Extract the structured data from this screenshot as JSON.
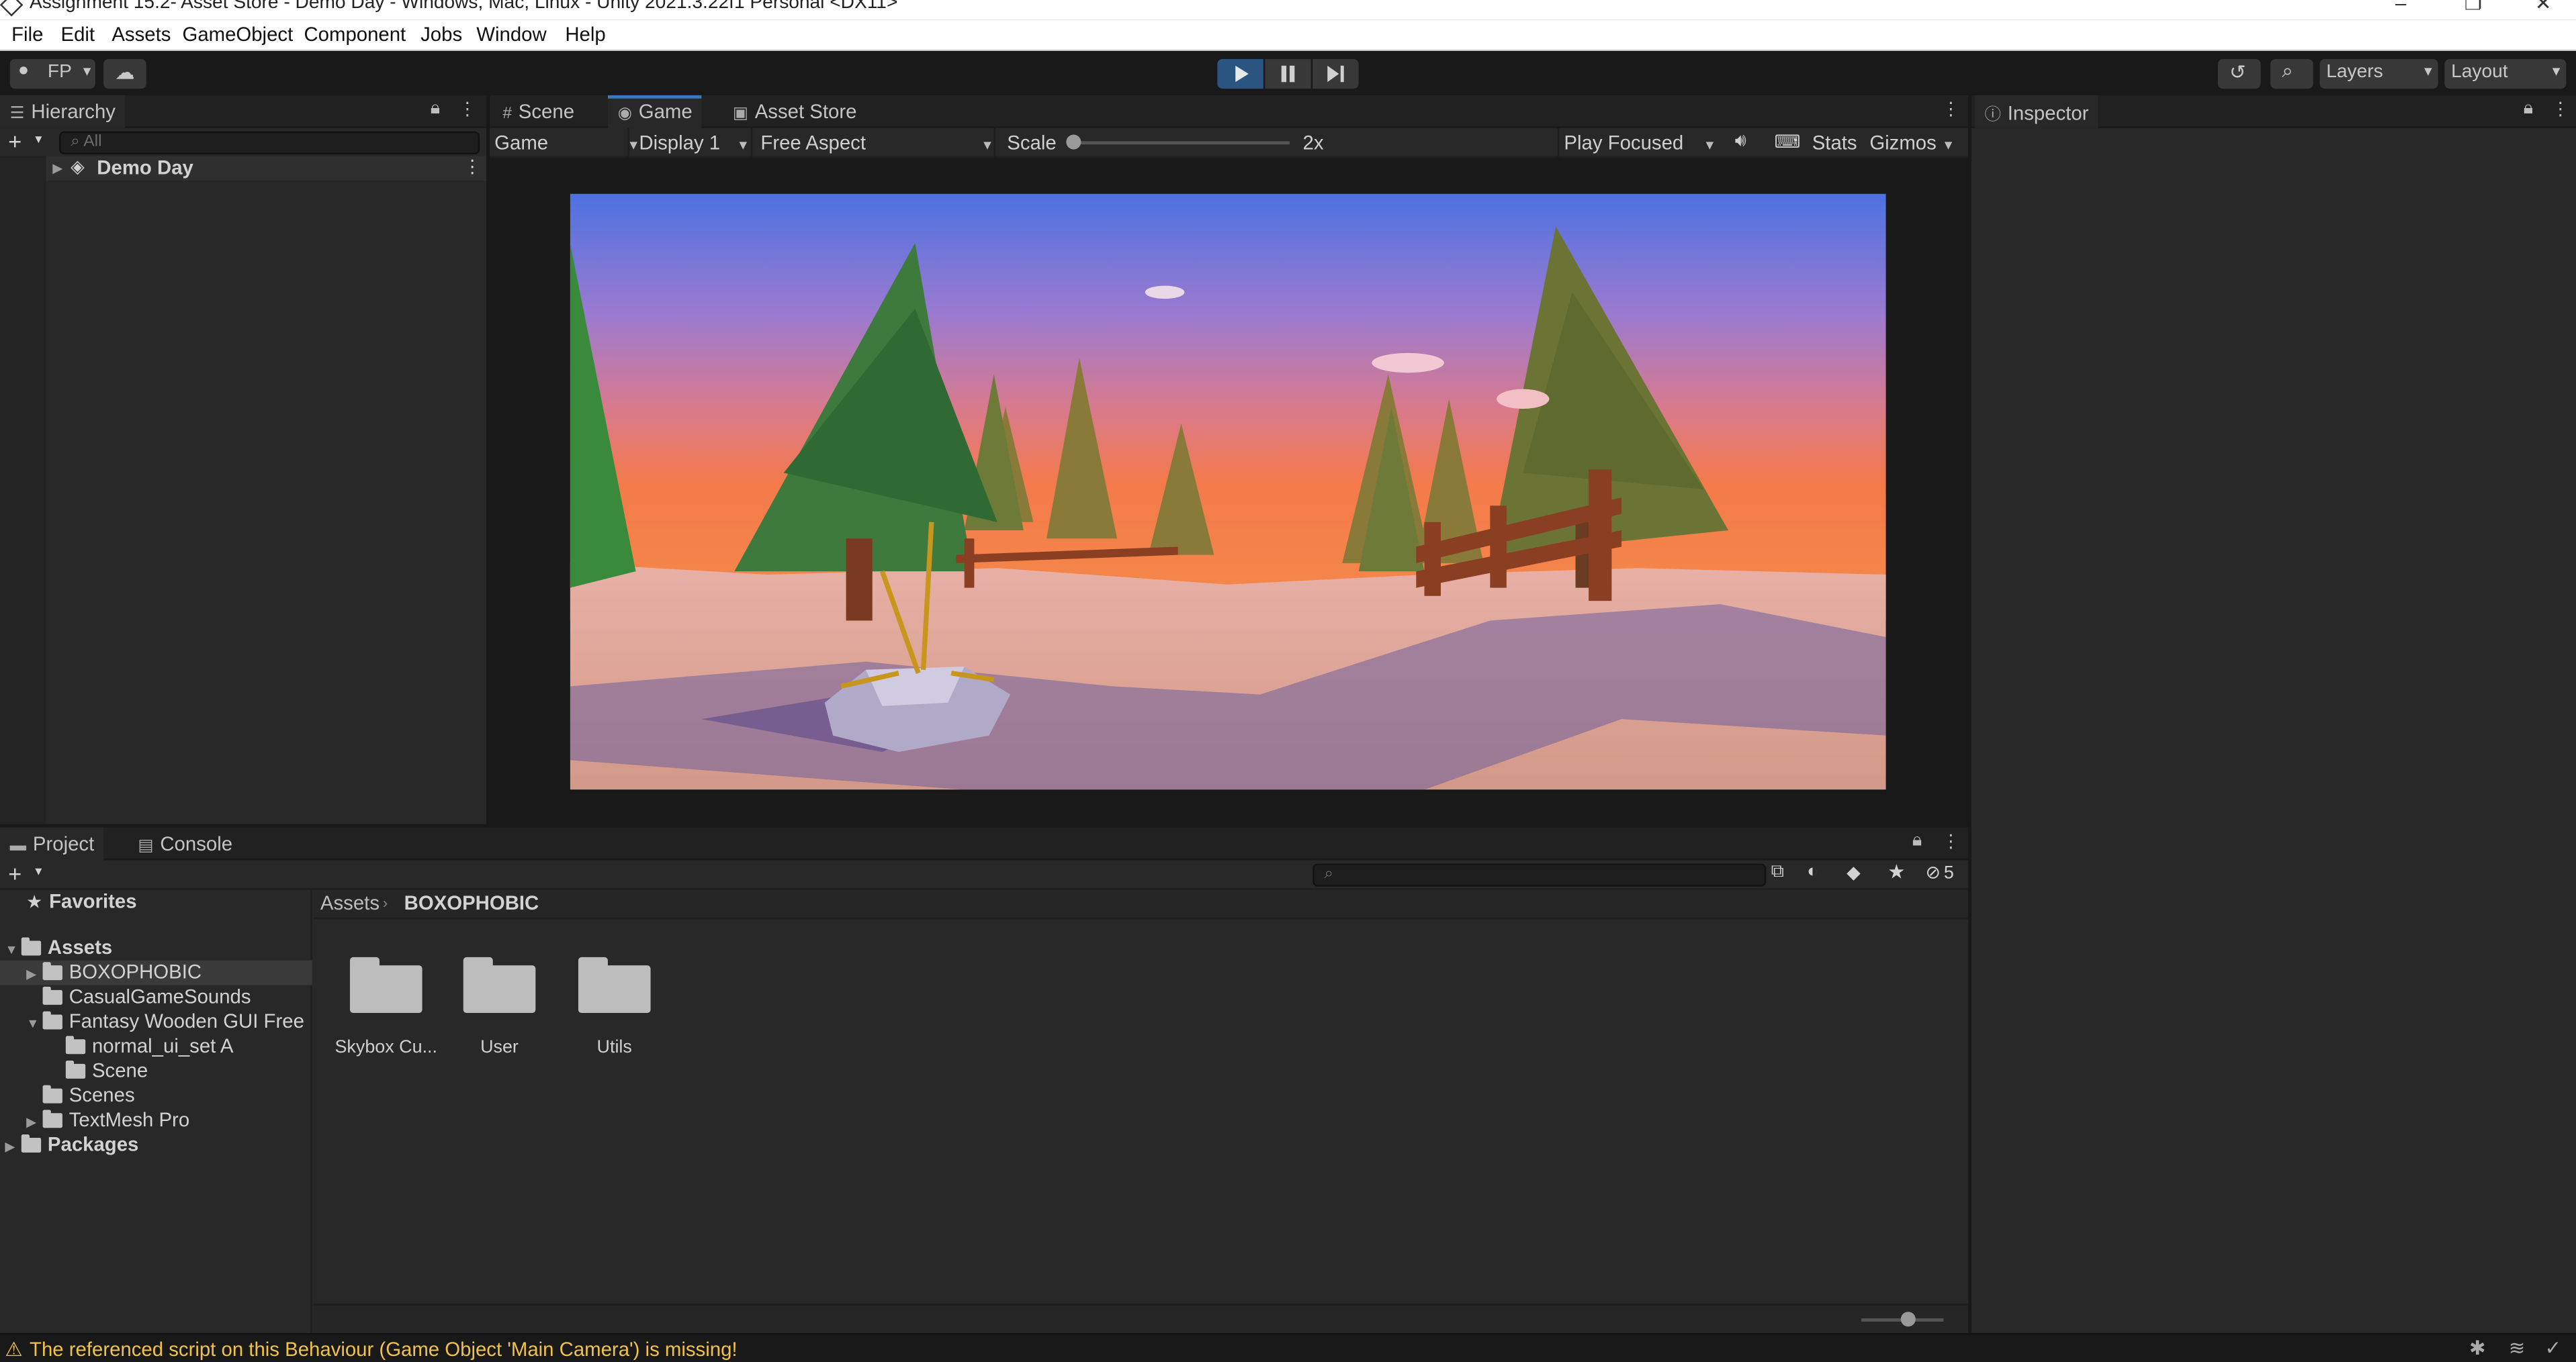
{
  "window": {
    "title": "Assignment 15.2- Asset Store - Demo Day - Windows, Mac, Linux - Unity 2021.3.22f1 Personal <DX11>"
  },
  "menu": [
    "File",
    "Edit",
    "Assets",
    "GameObject",
    "Component",
    "Jobs",
    "Window",
    "Help"
  ],
  "toolbar": {
    "account": "FP",
    "layers": "Layers",
    "layout": "Layout"
  },
  "hierarchy": {
    "tab": "Hierarchy",
    "search_placeholder": "All",
    "scene": "Demo Day"
  },
  "viewtabs": {
    "scene": "Scene",
    "game": "Game",
    "asset_store": "Asset Store"
  },
  "gamebar": {
    "mode": "Game",
    "display": "Display 1",
    "aspect": "Free Aspect",
    "scale_label": "Scale",
    "scale_value": "2x",
    "play_mode": "Play Focused",
    "stats": "Stats",
    "gizmos": "Gizmos"
  },
  "inspector": {
    "tab": "Inspector"
  },
  "project": {
    "tab": "Project",
    "console_tab": "Console",
    "hidden_count": "5",
    "favorites": "Favorites",
    "tree": [
      {
        "label": "Assets",
        "level": 0,
        "bold": true,
        "open": true
      },
      {
        "label": "BOXOPHOBIC",
        "level": 1,
        "arrow": true,
        "selected": true
      },
      {
        "label": "CasualGameSounds",
        "level": 1
      },
      {
        "label": "Fantasy Wooden GUI  Free",
        "level": 1,
        "arrow": true,
        "open": true
      },
      {
        "label": "normal_ui_set A",
        "level": 2
      },
      {
        "label": "Scene",
        "level": 2
      },
      {
        "label": "Scenes",
        "level": 1
      },
      {
        "label": "TextMesh Pro",
        "level": 1,
        "arrow": true
      },
      {
        "label": "Packages",
        "level": 0,
        "bold": true,
        "arrow": true
      }
    ],
    "breadcrumb": [
      "Assets",
      "BOXOPHOBIC"
    ],
    "folders": [
      "Skybox Cu...",
      "User",
      "Utils"
    ]
  },
  "status": {
    "message": "The referenced script on this Behaviour (Game Object 'Main Camera') is missing!"
  },
  "colors": {
    "accent": "#3a79bb",
    "play_active": "#2a5580",
    "warning": "#f0c24a"
  }
}
